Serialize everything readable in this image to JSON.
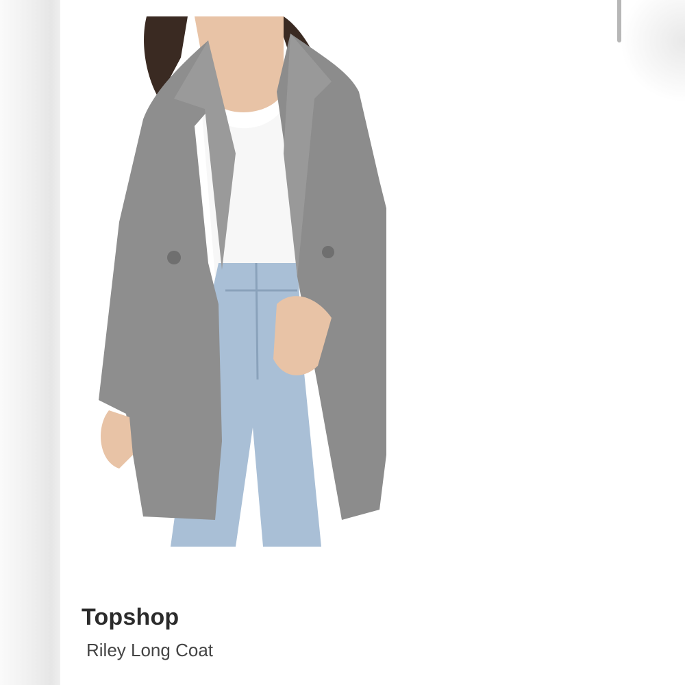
{
  "listing": {
    "brand": "Topshop",
    "product_name": "Riley Long Coat"
  },
  "image": {
    "icon": "product-photo-coat",
    "colors": {
      "coat": "#8e8e8e",
      "shirt": "#f7f7f7",
      "jeans": "#a9bfd6",
      "skin": "#e8c3a6",
      "hair": "#3a2a22"
    }
  }
}
